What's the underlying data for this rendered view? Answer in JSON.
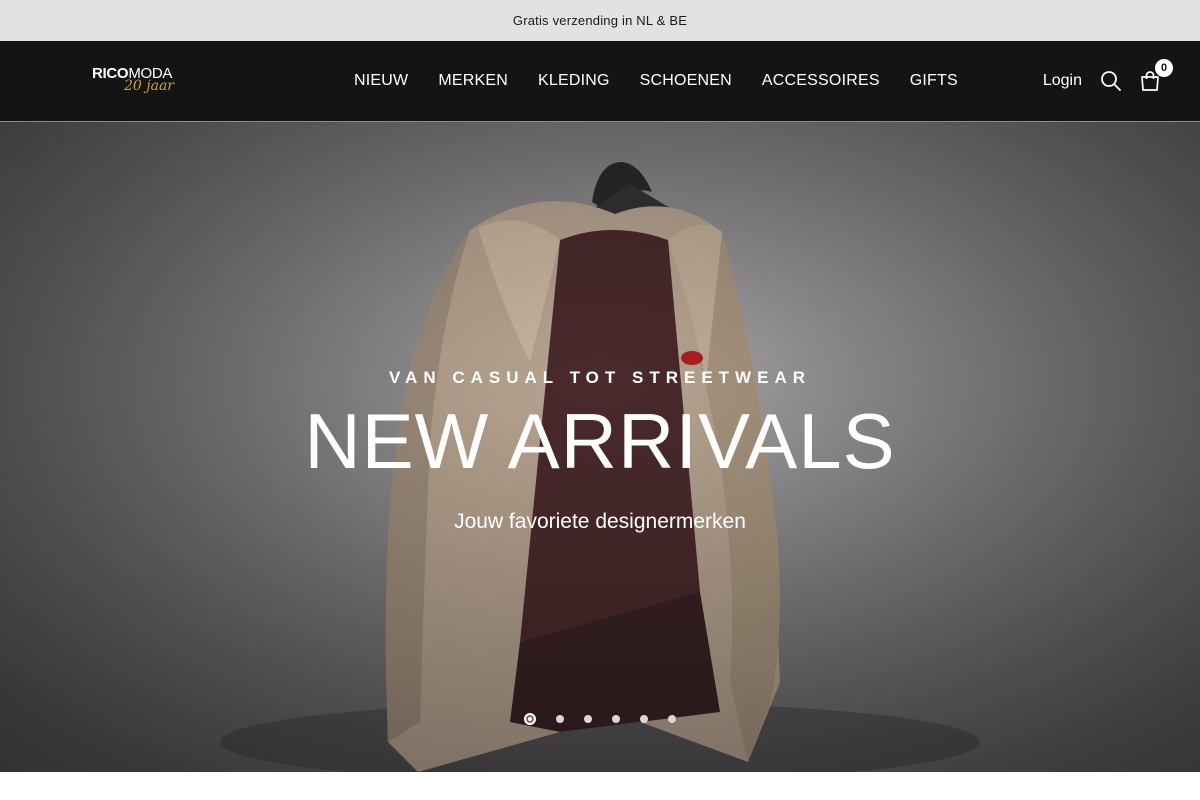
{
  "announcement": {
    "text": "Gratis verzending in NL & BE"
  },
  "header": {
    "logo": {
      "main_bold": "RICO",
      "main_light": "MODA",
      "sub": "20 jaar"
    },
    "nav": [
      {
        "label": "NIEUW"
      },
      {
        "label": "MERKEN"
      },
      {
        "label": "KLEDING"
      },
      {
        "label": "SCHOENEN"
      },
      {
        "label": "ACCESSOIRES"
      },
      {
        "label": "GIFTS"
      }
    ],
    "login_label": "Login",
    "cart_count": "0",
    "icons": {
      "search": "search-icon",
      "cart": "shopping-bag-icon"
    }
  },
  "hero": {
    "eyebrow": "VAN CASUAL TOT STREETWEAR",
    "title": "NEW ARRIVALS",
    "subtitle": "Jouw favoriete designermerken",
    "slides_count": 6,
    "active_slide": 1
  },
  "colors": {
    "header_bg": "#141414",
    "announce_bg": "#e2e2e2",
    "accent_gold": "#c9a14a"
  }
}
